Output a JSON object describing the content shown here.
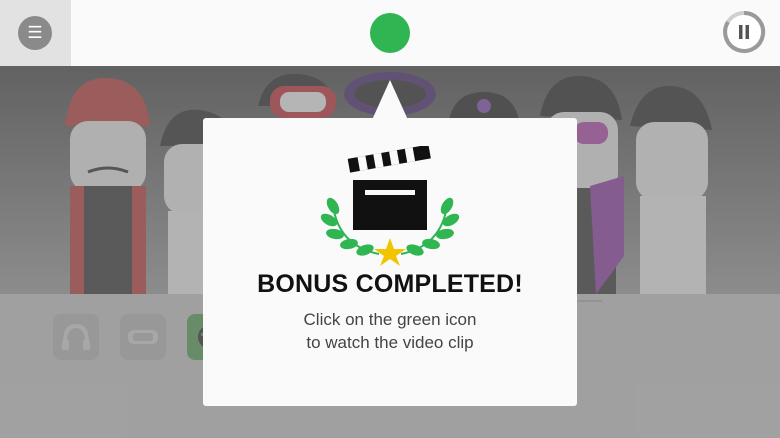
{
  "topbar": {
    "menu_icon": "hamburger-icon",
    "center_icon": "green-circle-icon",
    "pause_icon": "pause-icon",
    "accent_green": "#2fb552"
  },
  "stage": {
    "characters": [
      "red-hat-singer",
      "shirtless-singer",
      "goggles-singer",
      "purple-halo-singer",
      "headphones-singer",
      "purple-glasses-singer",
      "shirtless-singer-2"
    ]
  },
  "tray": {
    "slots": [
      "headphones-icon",
      "goggles-icon",
      "green-mask-icon"
    ]
  },
  "modal": {
    "title": "BONUS COMPLETED!",
    "line1": "Click on the green icon",
    "line2": "to watch the video clip",
    "art_icon": "clapperboard-laurel-star-icon"
  }
}
